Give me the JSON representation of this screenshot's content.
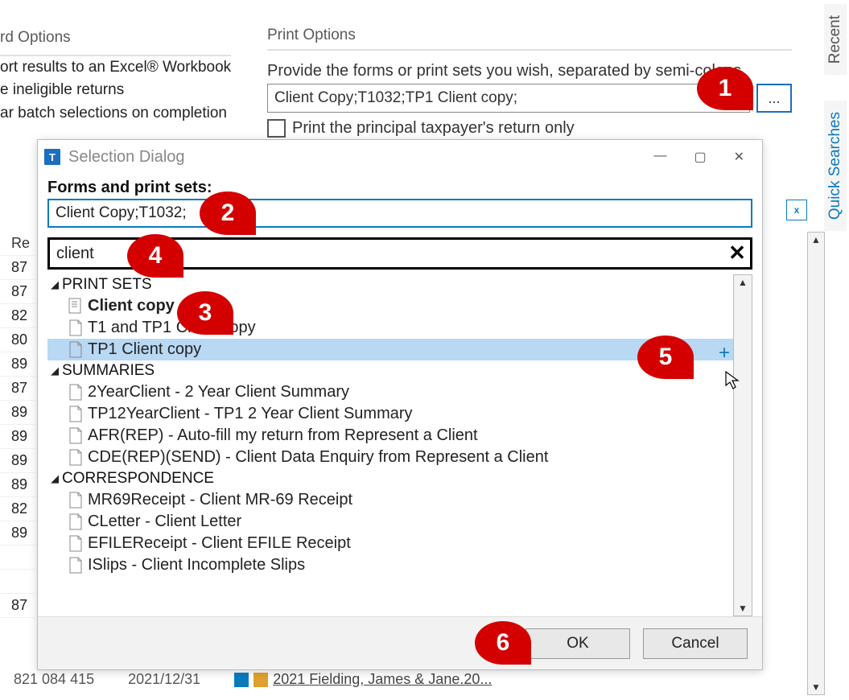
{
  "background": {
    "left_title": "rd Options",
    "options": [
      "ort results to an Excel® Workbook",
      "e ineligible returns",
      "ar batch selections on completion"
    ],
    "print_title": "Print Options",
    "print_desc": "Provide the forms or print sets you wish, separated by semi-colons",
    "print_input": "Client Copy;T1032;TP1 Client copy;",
    "browse_label": "...",
    "principal_cb": "Print the principal taxpayer's return only",
    "col_header": "Re",
    "left_nums": [
      "87",
      "87",
      "82",
      "80",
      "89",
      "87",
      "89",
      "89",
      "89",
      "89",
      "82",
      "89",
      "",
      "",
      "87"
    ],
    "peek_code": "821 084 415",
    "peek_date": "2021/12/31",
    "peek_link": "2021 Fielding, James & Jane.20..."
  },
  "right_tabs": {
    "recent": "Recent",
    "qs": "Quick Searches"
  },
  "dialog": {
    "title": "Selection Dialog",
    "forms_label": "Forms and print sets:",
    "forms_value": "Client Copy;T1032;",
    "search_value": "client",
    "sections": {
      "print_sets": "PRINT SETS",
      "summaries": "SUMMARIES",
      "correspondence": "CORRESPONDENCE"
    },
    "items": {
      "ps": [
        "Client copy",
        "T1 and TP1 Client copy",
        "TP1 Client copy"
      ],
      "sum": [
        "2YearClient - 2 Year Client Summary",
        "TP12YearClient - TP1 2 Year Client Summary",
        "AFR(REP) - Auto-fill my return from Represent a Client",
        "CDE(REP)(SEND) - Client Data Enquiry from Represent a Client"
      ],
      "cor": [
        "MR69Receipt - Client MR-69 Receipt",
        "CLetter - Client Letter",
        "EFILEReceipt - Client EFILE Receipt",
        "ISlips - Client Incomplete Slips"
      ]
    },
    "ok": "OK",
    "cancel": "Cancel"
  },
  "callouts": {
    "1": "1",
    "2": "2",
    "3": "3",
    "4": "4",
    "5": "5",
    "6": "6"
  }
}
